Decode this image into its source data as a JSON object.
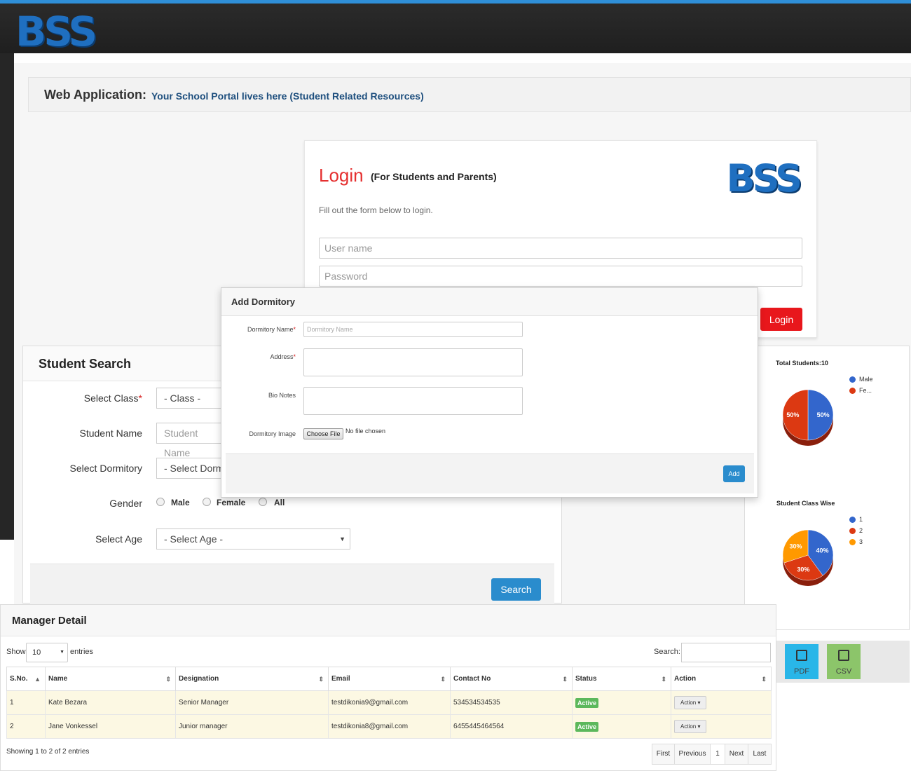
{
  "brand": {
    "logo": "BSS"
  },
  "header": {
    "title": "Web Application:",
    "subtitle": "Your School Portal lives here (Student Related Resources)"
  },
  "login": {
    "title": "Login",
    "subtitle": "(For Students and Parents)",
    "logo": "BSS",
    "hint": "Fill out the form below to login.",
    "username_placeholder": "User name",
    "password_placeholder": "Password",
    "button": "Login"
  },
  "student_search": {
    "title": "Student Search",
    "class_label": "Select Class",
    "class_value": "- Class -",
    "name_label": "Student Name",
    "name_placeholder": "Student Name",
    "dorm_label": "Select Dormitory",
    "dorm_value": "- Select Dorm",
    "gender_label": "Gender",
    "gender_options": [
      "Male",
      "Female",
      "All"
    ],
    "age_label": "Select Age",
    "age_value": "- Select Age -",
    "search_button": "Search"
  },
  "modal": {
    "title": "Add Dormitory",
    "dorm_name_label": "Dormitory Name",
    "dorm_name_placeholder": "Dormitory Name",
    "address_label": "Address",
    "bio_label": "Bio Notes",
    "image_label": "Dormitory Image",
    "choose_file": "Choose File",
    "no_file": "No file chosen",
    "add_button": "Add"
  },
  "charts": {
    "total_title": "Total Students:10",
    "total_legend": [
      "Male",
      "Fe..."
    ],
    "class_title": "Student Class Wise",
    "class_legend": [
      "1",
      "2",
      "3"
    ]
  },
  "chart_data": [
    {
      "type": "pie",
      "title": "Total Students:10",
      "categories": [
        "Male",
        "Fe..."
      ],
      "values": [
        50,
        50
      ],
      "colors": [
        "#3366cc",
        "#dc3912"
      ]
    },
    {
      "type": "pie",
      "title": "Student Class Wise",
      "categories": [
        "1",
        "2",
        "3"
      ],
      "values": [
        40,
        30,
        30
      ],
      "colors": [
        "#3366cc",
        "#dc3912",
        "#ff9900"
      ]
    }
  ],
  "export": {
    "pdf": "PDF",
    "csv": "CSV"
  },
  "manager": {
    "title": "Manager Detail",
    "show": "Show",
    "entries_value": "10",
    "entries": "entries",
    "search_label": "Search:",
    "columns": [
      "S.No.",
      "Name",
      "Designation",
      "Email",
      "Contact No",
      "Status",
      "Action"
    ],
    "rows": [
      [
        "1",
        "Kate Bezara",
        "Senior Manager",
        "testdikonia9@gmail.com",
        "534534534535",
        "Active",
        "Action"
      ],
      [
        "2",
        "Jane Vonkessel",
        "Junior manager",
        "testdikonia8@gmail.com",
        "6455445464564",
        "Active",
        "Action"
      ]
    ],
    "showing": "Showing 1 to 2 of 2 entries",
    "pagination": [
      "First",
      "Previous",
      "1",
      "Next",
      "Last"
    ]
  },
  "colors": {
    "accent": "#2a8ccd",
    "login_red": "#e53030",
    "topbar": "#222222",
    "status_green": "#5cb85c"
  }
}
